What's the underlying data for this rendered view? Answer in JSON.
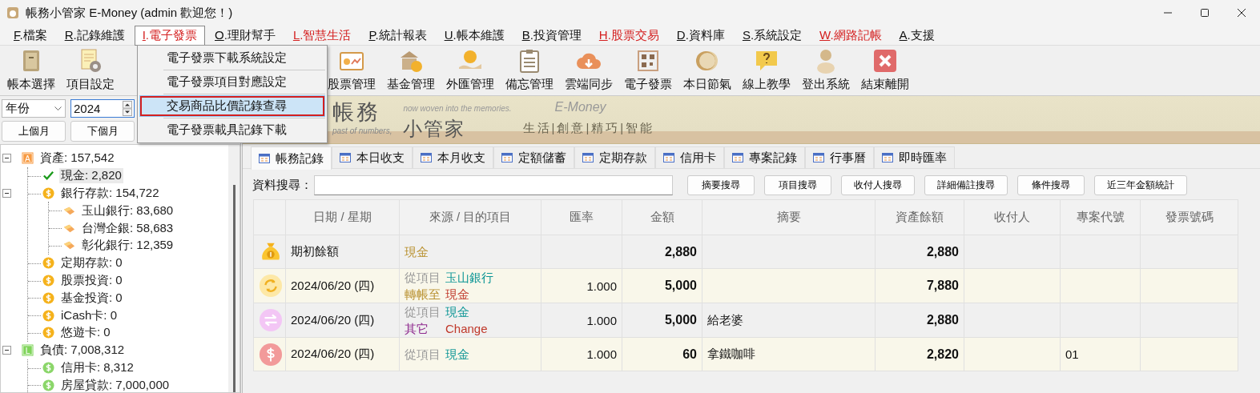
{
  "window": {
    "title": "帳務小管家 E-Money (admin 歡迎您！)"
  },
  "menu": [
    {
      "label": "F.檔案",
      "highlight": false,
      "selected": false
    },
    {
      "label": "R.記錄維護",
      "highlight": false,
      "selected": false
    },
    {
      "label": "I.電子發票",
      "highlight": true,
      "selected": true
    },
    {
      "label": "O.理財幫手",
      "highlight": false,
      "selected": false
    },
    {
      "label": "L.智慧生活",
      "highlight": true,
      "selected": false
    },
    {
      "label": "P.統計報表",
      "highlight": false,
      "selected": false
    },
    {
      "label": "U.帳本維護",
      "highlight": false,
      "selected": false
    },
    {
      "label": "B.投資管理",
      "highlight": false,
      "selected": false
    },
    {
      "label": "H.股票交易",
      "highlight": true,
      "selected": false
    },
    {
      "label": "D.資料庫",
      "highlight": false,
      "selected": false
    },
    {
      "label": "S.系統設定",
      "highlight": false,
      "selected": false
    },
    {
      "label": "W.網路記帳",
      "highlight": true,
      "selected": false
    },
    {
      "label": "A.支援",
      "highlight": false,
      "selected": false
    }
  ],
  "dropdown": [
    {
      "label": "電子發票下載系統設定",
      "selected": false,
      "marked": false
    },
    {
      "label": "電子發票項目對應設定",
      "selected": false,
      "marked": false
    },
    {
      "label": "交易商品比價記錄查尋",
      "selected": true,
      "marked": true
    },
    {
      "label": "電子發票載具記錄下載",
      "selected": false,
      "marked": false
    }
  ],
  "toolbar": [
    {
      "label": "帳本選擇",
      "kind": "book"
    },
    {
      "label": "項目設定",
      "kind": "settings"
    },
    {
      "kind": "hidden"
    },
    {
      "kind": "hidden"
    },
    {
      "label": "股票管理",
      "kind": "chart"
    },
    {
      "label": "基金管理",
      "kind": "bank"
    },
    {
      "label": "外匯管理",
      "kind": "coinhand"
    },
    {
      "label": "備忘管理",
      "kind": "memo"
    },
    {
      "label": "雲端同步",
      "kind": "cloud"
    },
    {
      "label": "電子發票",
      "kind": "qr"
    },
    {
      "label": "本日節氣",
      "kind": "season"
    },
    {
      "label": "線上教學",
      "kind": "help"
    },
    {
      "label": "登出系統",
      "kind": "person"
    },
    {
      "label": "結束離開",
      "kind": "exit"
    }
  ],
  "period": {
    "mode": "年份",
    "year": "2024",
    "buttons": [
      "上個月",
      "下個月"
    ]
  },
  "tree": [
    {
      "label": "資產: 157,542",
      "kind": "badge",
      "badge": "A",
      "color": "#f79a42",
      "expanded": true,
      "selected": false,
      "children": [
        {
          "label": "現金: 2,820",
          "kind": "check",
          "selected": true
        },
        {
          "label": "銀行存款: 154,722",
          "kind": "coin",
          "color": "#f5b21c",
          "expanded": true,
          "selected": false,
          "children": [
            {
              "label": "玉山銀行: 83,680",
              "kind": "tag",
              "selected": false
            },
            {
              "label": "台灣企銀: 58,683",
              "kind": "tag",
              "selected": false
            },
            {
              "label": "彰化銀行: 12,359",
              "kind": "tag",
              "selected": false
            }
          ]
        },
        {
          "label": "定期存款: 0",
          "kind": "coin",
          "color": "#f5b21c",
          "selected": false
        },
        {
          "label": "股票投資: 0",
          "kind": "coin",
          "color": "#f5b21c",
          "selected": false
        },
        {
          "label": "基金投資: 0",
          "kind": "coin",
          "color": "#f5b21c",
          "selected": false
        },
        {
          "label": "iCash卡: 0",
          "kind": "coin",
          "color": "#f5b21c",
          "selected": false
        },
        {
          "label": "悠遊卡: 0",
          "kind": "coin",
          "color": "#f5b21c",
          "selected": false
        }
      ]
    },
    {
      "label": "負債: 7,008,312",
      "kind": "badge",
      "badge": "L",
      "color": "#7fd45a",
      "expanded": true,
      "selected": false,
      "children": [
        {
          "label": "信用卡: 8,312",
          "kind": "coin",
          "color": "#8bd66a",
          "selected": false
        },
        {
          "label": "房屋貸款: 7,000,000",
          "kind": "coin",
          "color": "#8bd66a",
          "selected": false
        }
      ]
    }
  ],
  "banner": {
    "title": "帳務",
    "subtitle": "past of numbers,",
    "tagline": "now woven into the memories.",
    "name": "小管家",
    "brand": "E-Money",
    "motto": "生活|創意|精巧|智能"
  },
  "tabs": [
    {
      "label": "帳務記錄",
      "selected": true
    },
    {
      "label": "本日收支",
      "selected": false
    },
    {
      "label": "本月收支",
      "selected": false
    },
    {
      "label": "定額儲蓄",
      "selected": false
    },
    {
      "label": "定期存款",
      "selected": false
    },
    {
      "label": "信用卡",
      "selected": false
    },
    {
      "label": "專案記錄",
      "selected": false
    },
    {
      "label": "行事曆",
      "selected": false
    },
    {
      "label": "即時匯率",
      "selected": false
    }
  ],
  "search": {
    "label": "資料搜尋：",
    "buttons": [
      "摘要搜尋",
      "項目搜尋",
      "收付人搜尋",
      "詳細備註搜尋",
      "條件搜尋",
      "近三年金額統計"
    ]
  },
  "table": {
    "columns": [
      "日期 / 星期",
      "來源 / 目的項目",
      "匯率",
      "金額",
      "摘要",
      "資產餘額",
      "收付人",
      "專案代號",
      "發票號碼"
    ],
    "rows": [
      {
        "kind": "opening",
        "date": "期初餘額",
        "source": [
          {
            "kind": "opening",
            "value": "現金"
          }
        ],
        "amount": "2,880",
        "balance": "2,880"
      },
      {
        "kind": "transfer",
        "date": "2024/06/20 (四)",
        "source": [
          {
            "kind": "from",
            "label": "從項目",
            "value": "玉山銀行"
          },
          {
            "kind": "to",
            "label": "轉帳至",
            "value": "現金"
          }
        ],
        "rate": "1.000",
        "amount": "5,000",
        "balance": "7,880"
      },
      {
        "kind": "other",
        "date": "2024/06/20 (四)",
        "source": [
          {
            "kind": "from",
            "label": "從項目",
            "value": "現金"
          },
          {
            "kind": "other",
            "label": "其它",
            "value": "Change"
          }
        ],
        "rate": "1.000",
        "amount": "5,000",
        "summary": "給老婆",
        "balance": "2,880"
      },
      {
        "kind": "expense",
        "date": "2024/06/20 (四)",
        "source": [
          {
            "kind": "from",
            "label": "從項目",
            "value": "現金"
          }
        ],
        "rate": "1.000",
        "amount": "60",
        "summary": "拿鐵咖啡",
        "balance": "2,820",
        "project": "01"
      }
    ]
  }
}
